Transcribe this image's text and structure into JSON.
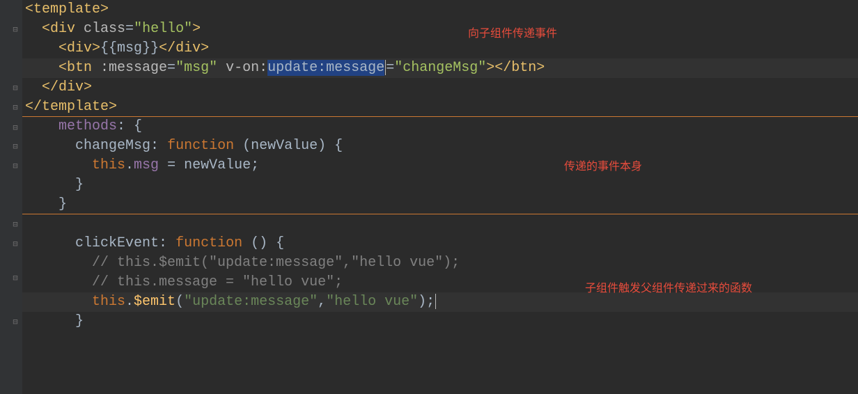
{
  "annotations": {
    "a1": "向子组件传递事件",
    "a2": "传递的事件本身",
    "a3": "子组件触发父组件传递过来的函数"
  },
  "code": {
    "l1_open": "<template>",
    "l2_indent": "  ",
    "l2_open": "<div ",
    "l2_attr": "class",
    "l2_eq": "=",
    "l2_val": "\"hello\"",
    "l2_close": ">",
    "l3_indent": "    ",
    "l3_open": "<div>",
    "l3_text": "{{",
    "l3_var": "msg",
    "l3_text2": "}}",
    "l3_close": "</div>",
    "l4_indent": "    ",
    "l4_open": "<btn ",
    "l4_attr1": ":message",
    "l4_eq1": "=",
    "l4_val1": "\"",
    "l4_val1_inner": "msg",
    "l4_val1_close": "\"",
    "l4_sp": " ",
    "l4_attr2": "v-on",
    "l4_colon": ":",
    "l4_sel": "update:message",
    "l4_eq2": "=",
    "l4_val2": "\"changeMsg\"",
    "l4_close": "></btn>",
    "l5_indent": "  ",
    "l5": "</div>",
    "l6": "</template>",
    "l7_indent": "    ",
    "l7_prop": "methods",
    "l7_punct": ": {",
    "l8_indent": "      ",
    "l8_name": "changeMsg",
    "l8_colon": ": ",
    "l8_kw": "function",
    "l8_params": " (newValue) {",
    "l9_indent": "        ",
    "l9_this": "this",
    "l9_dot": ".",
    "l9_prop": "msg",
    "l9_rest": " = newValue;",
    "l10_indent": "      ",
    "l10": "}",
    "l11_indent": "    ",
    "l11": "}",
    "l12_blank": "",
    "l13_indent": "      ",
    "l13_name": "clickEvent",
    "l13_colon": ": ",
    "l13_kw": "function",
    "l13_params": " () {",
    "l14_indent": "        ",
    "l14": "// this.$emit(\"update:message\",\"hello vue\");",
    "l15_indent": "        ",
    "l15": "// this.message = \"hello vue\";",
    "l16_indent": "        ",
    "l16_this": "this",
    "l16_dot": ".",
    "l16_emit": "$emit",
    "l16_paren": "(",
    "l16_str1": "\"update:message\"",
    "l16_comma": ",",
    "l16_str2": "\"hello vue\"",
    "l16_close": ");",
    "l17_indent": "      ",
    "l17": "}"
  }
}
